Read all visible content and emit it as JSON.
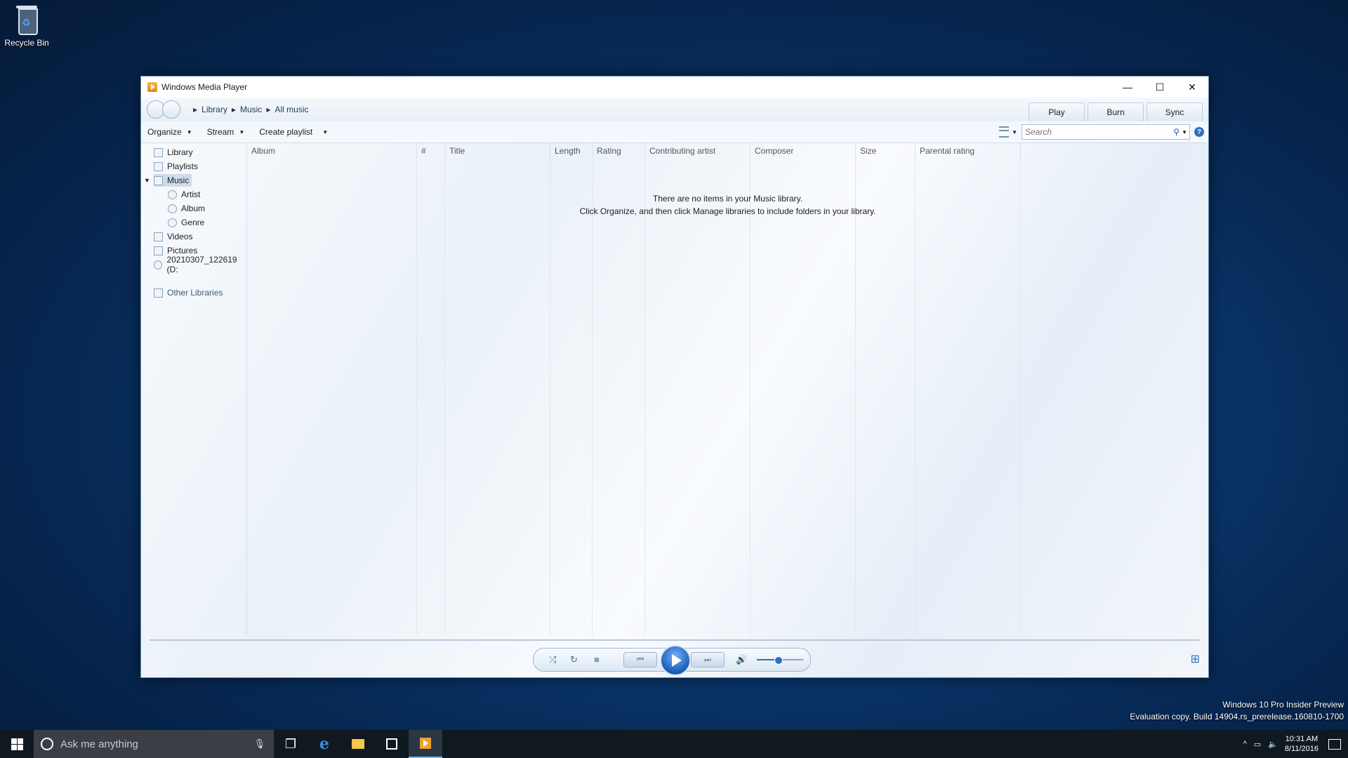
{
  "desktop": {
    "recycle_bin_label": "Recycle Bin"
  },
  "window": {
    "title": "Windows Media Player",
    "controls": {
      "minimize": "—",
      "maximize": "☐",
      "close": "✕"
    }
  },
  "breadcrumb": [
    "Library",
    "Music",
    "All music"
  ],
  "tabs": [
    "Play",
    "Burn",
    "Sync"
  ],
  "toolbar": {
    "organize": "Organize",
    "stream": "Stream",
    "create_playlist": "Create playlist",
    "search_placeholder": "Search"
  },
  "sidebar": {
    "items": [
      {
        "label": "Library"
      },
      {
        "label": "Playlists"
      },
      {
        "label": "Music"
      },
      {
        "label": "Artist"
      },
      {
        "label": "Album"
      },
      {
        "label": "Genre"
      },
      {
        "label": "Videos"
      },
      {
        "label": "Pictures"
      },
      {
        "label": "20210307_122619 (D:"
      },
      {
        "label": "Other Libraries"
      }
    ],
    "selected": "Music"
  },
  "columns": [
    "Album",
    "#",
    "Title",
    "Length",
    "Rating",
    "Contributing artist",
    "Composer",
    "Size",
    "Parental rating"
  ],
  "empty_message": {
    "line1": "There are no items in your Music library.",
    "line2": "Click Organize, and then click Manage libraries to include folders in your library."
  },
  "player": {
    "volume": 0.45
  },
  "watermark": {
    "line1": "Windows 10 Pro Insider Preview",
    "line2": "Evaluation copy. Build 14904.rs_prerelease.160810-1700"
  },
  "taskbar": {
    "search_placeholder": "Ask me anything",
    "time": "10:31 AM",
    "date": "8/11/2016"
  }
}
